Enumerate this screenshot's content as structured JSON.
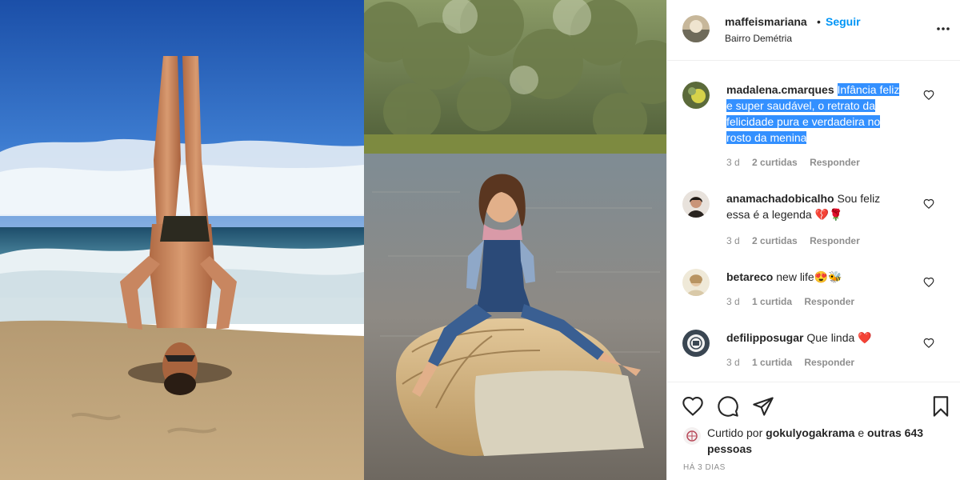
{
  "post_header": {
    "username": "maffeismariana",
    "separator": "•",
    "follow_label": "Seguir",
    "location": "Bairro Demétria"
  },
  "comments": [
    {
      "username": "madalena.cmarques",
      "text": "Infância feliz e super saudável, o retrato da felicidade pura e verdadeira no rosto da menina",
      "time": "3 d",
      "likes": "2 curtidas",
      "reply": "Responder"
    },
    {
      "username": "anamachadobicalho",
      "text": "Sou feliz essa é a legenda 💔🌹",
      "time": "3 d",
      "likes": "2 curtidas",
      "reply": "Responder"
    },
    {
      "username": "betareco",
      "text": "new life😍🐝",
      "time": "3 d",
      "likes": "1 curtida",
      "reply": "Responder"
    },
    {
      "username": "defilipposugar",
      "text": "Que linda ❤️",
      "time": "3 d",
      "likes": "1 curtida",
      "reply": "Responder"
    }
  ],
  "liked_by": {
    "prefix": "Curtido por",
    "user": "gokulyogakrama",
    "joiner": "e",
    "others": "outras 643 pessoas"
  },
  "timestamp": "HÁ 3 DIAS",
  "icons": {
    "like": "heart-icon",
    "comment": "comment-icon",
    "share": "paper-plane-icon",
    "save": "bookmark-icon",
    "more": "more-options-icon"
  },
  "colors": {
    "accent": "#0095f6",
    "selection": "#3390ff",
    "heart_red": "#ed4956",
    "text": "#262626",
    "muted": "#8e8e8e"
  }
}
